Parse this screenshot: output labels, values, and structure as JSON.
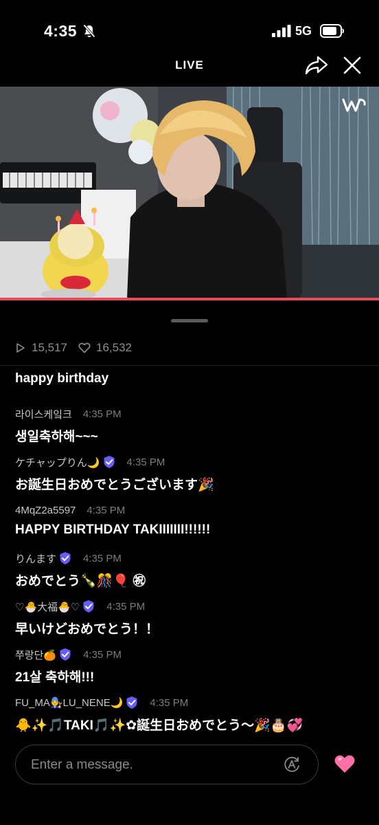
{
  "status_bar": {
    "time": "4:35",
    "network": "5G"
  },
  "header": {
    "title": "LIVE"
  },
  "stats": {
    "views": "15,517",
    "likes": "16,532"
  },
  "chat": [
    {
      "user": "",
      "time": "",
      "verified": false,
      "text": "happy birthday"
    },
    {
      "user": "라이스케잌크",
      "time": "4:35 PM",
      "verified": false,
      "text": "생일축하해~~~"
    },
    {
      "user": "ケチャップりん🌙",
      "time": "4:35 PM",
      "verified": true,
      "text": "お誕生日おめでとうございます🎉"
    },
    {
      "user": "4MqZ2a5597",
      "time": "4:35 PM",
      "verified": false,
      "text": "HAPPY BIRTHDAY TAKIIIIIII!!!!!!"
    },
    {
      "user": "りんます",
      "time": "4:35 PM",
      "verified": true,
      "text": "おめでとう🍾🎊🎈 ㊗"
    },
    {
      "user": "♡🐣大福🐣♡",
      "time": "4:35 PM",
      "verified": true,
      "text": "早いけどおめでとう！！"
    },
    {
      "user": "쭈랑단🍊",
      "time": "4:35 PM",
      "verified": true,
      "text": "21살 축하해!!!"
    },
    {
      "user": "FU_MA🧑‍🔧LU_NENE🌙",
      "time": "4:35 PM",
      "verified": true,
      "text": "🐥✨🎵TAKI🎵✨✿誕生日おめでとう～🎉🎂💞"
    }
  ],
  "input": {
    "placeholder": "Enter a message."
  },
  "colors": {
    "progress": "#e84a5c",
    "verified": "#6a5cf5",
    "heart": "#ff6fa8"
  },
  "icons": [
    "mute-icon",
    "signal-icon",
    "battery-icon",
    "share-icon",
    "close-icon",
    "weverse-logo",
    "play-icon",
    "heart-outline-icon",
    "verified-icon",
    "translate-icon",
    "heart-icon"
  ]
}
